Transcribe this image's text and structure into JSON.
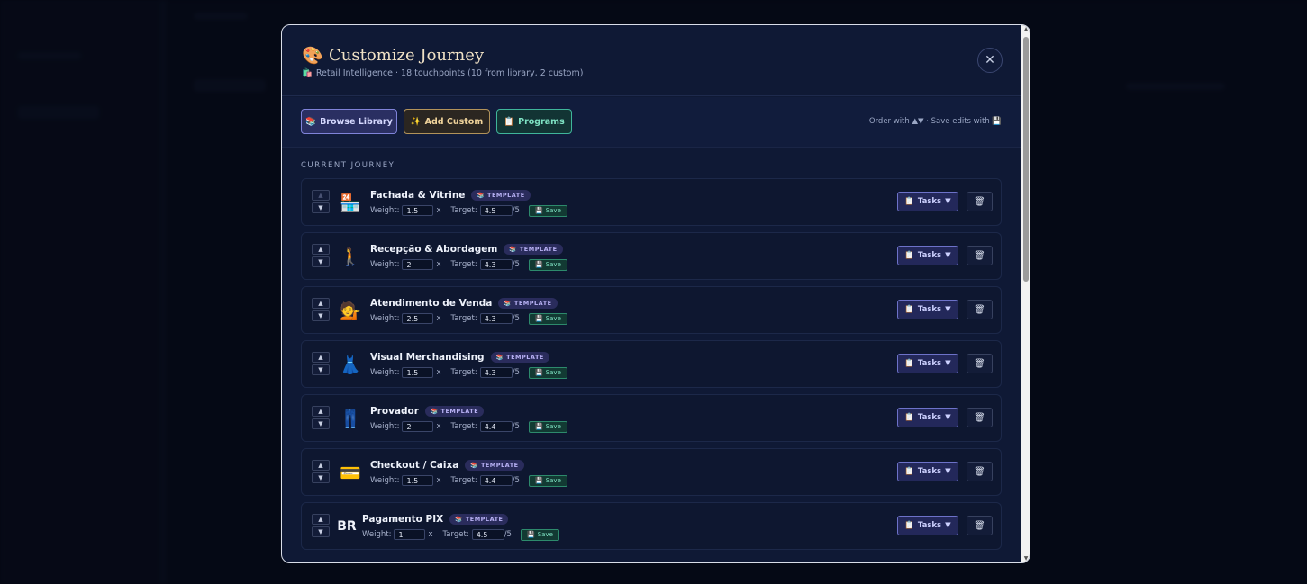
{
  "modal": {
    "title_icon": "🎨",
    "title": "Customize Journey",
    "subtitle_icon": "🛍️",
    "subtitle": "Retail Intelligence · 18 touchpoints (10 from library, 2 custom)",
    "close_icon": "✕"
  },
  "toolbar": {
    "browse_icon": "📚",
    "browse_label": "Browse Library",
    "add_icon": "✨",
    "add_label": "Add Custom",
    "programs_icon": "📋",
    "programs_label": "Programs",
    "hint": "Order with ▲▼ · Save edits with 💾"
  },
  "section_label": "CURRENT JOURNEY",
  "row_labels": {
    "weight": "Weight:",
    "target": "Target:",
    "times": "x",
    "out_of": "/5",
    "badge": "TEMPLATE",
    "badge_icon": "📚",
    "save": "Save",
    "save_icon": "💾",
    "tasks": "Tasks",
    "tasks_icon": "📋",
    "tasks_caret": "▼",
    "delete_icon": "🗑",
    "up": "▲",
    "down": "▼"
  },
  "touchpoints": [
    {
      "icon": "🏪",
      "name": "Fachada & Vitrine",
      "weight": "1.5",
      "target": "4.5"
    },
    {
      "icon": "🚶",
      "name": "Recepção & Abordagem",
      "weight": "2",
      "target": "4.3"
    },
    {
      "icon": "💁",
      "name": "Atendimento de Venda",
      "weight": "2.5",
      "target": "4.3"
    },
    {
      "icon": "👗",
      "name": "Visual Merchandising",
      "weight": "1.5",
      "target": "4.3"
    },
    {
      "icon": "👖",
      "name": "Provador",
      "weight": "2",
      "target": "4.4"
    },
    {
      "icon": "💳",
      "name": "Checkout / Caixa",
      "weight": "1.5",
      "target": "4.4"
    },
    {
      "icon": "BR",
      "name": "Pagamento PIX",
      "weight": "1",
      "target": "4.5"
    }
  ]
}
